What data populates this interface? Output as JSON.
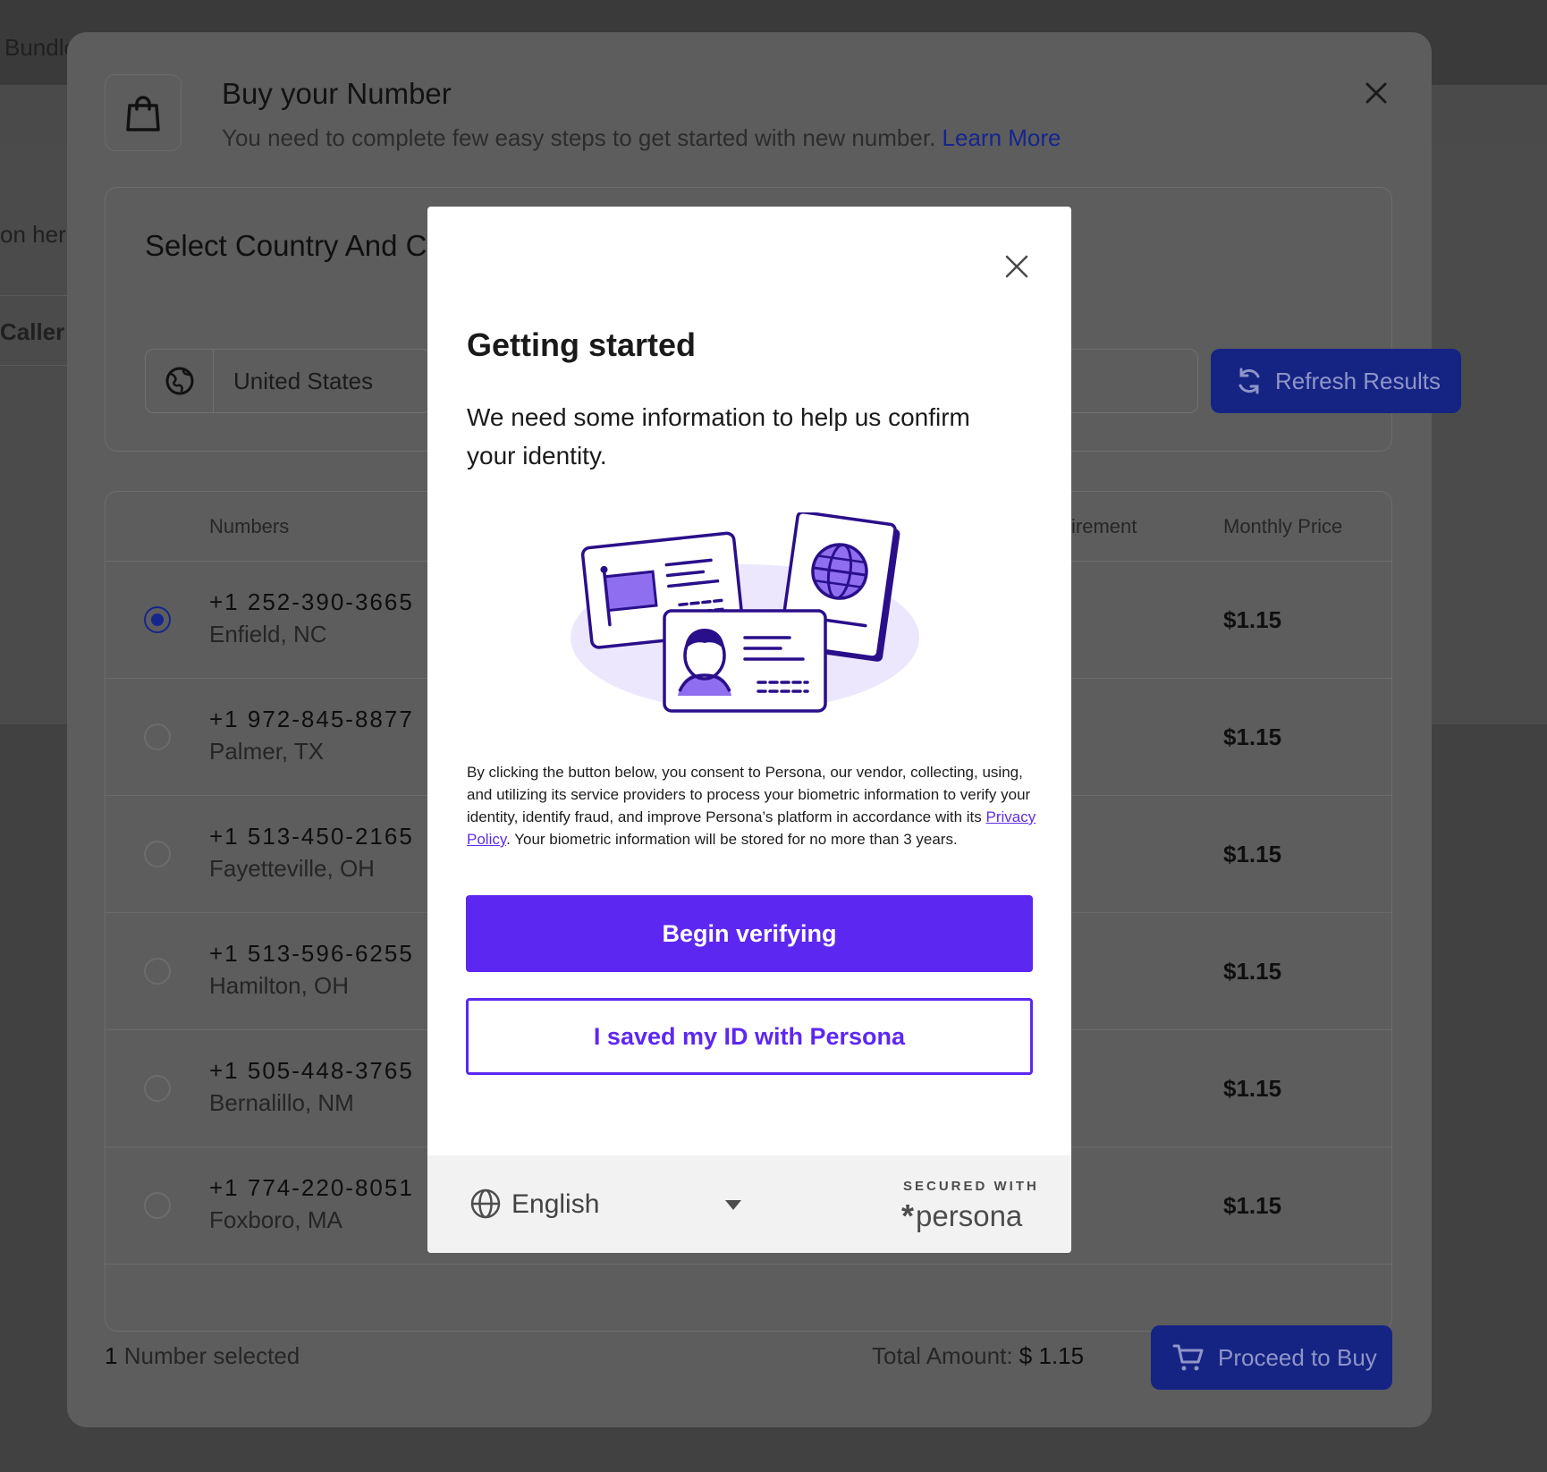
{
  "background": {
    "partial_texts": [
      "Bundle",
      "on her",
      "Caller"
    ]
  },
  "modal": {
    "title": "Buy your Number",
    "subtitle": "You need to complete few easy steps to get started with new number.",
    "learn_more": "Learn More",
    "select_title": "Select Country And C",
    "country_value": "United States",
    "refresh_label": "Refresh Results",
    "table": {
      "headers": [
        "Numbers",
        "irement",
        "Monthly Price"
      ],
      "rows": [
        {
          "number": "+1 252-390-3665",
          "location": "Enfield, NC",
          "price": "$1.15",
          "selected": true
        },
        {
          "number": "+1 972-845-8877",
          "location": "Palmer, TX",
          "price": "$1.15",
          "selected": false
        },
        {
          "number": "+1 513-450-2165",
          "location": "Fayetteville, OH",
          "price": "$1.15",
          "selected": false
        },
        {
          "number": "+1 513-596-6255",
          "location": "Hamilton, OH",
          "price": "$1.15",
          "selected": false
        },
        {
          "number": "+1 505-448-3765",
          "location": "Bernalillo, NM",
          "price": "$1.15",
          "selected": false
        },
        {
          "number": "+1 774-220-8051",
          "location": "Foxboro, MA",
          "price": "$1.15",
          "selected": false
        }
      ]
    },
    "footer": {
      "selected_count": "1",
      "selected_text": "Number selected",
      "total_label": "Total Amount:",
      "total_value": "$ 1.15",
      "proceed_label": "Proceed to Buy"
    }
  },
  "dialog": {
    "title": "Getting started",
    "body": "We need some information to help us confirm your identity.",
    "consent_before": "By clicking the button below, you consent to Persona, our vendor, collecting, using, and utilizing its service providers to process your biometric information to verify your identity, identify fraud, and improve Persona’s platform in accordance with its ",
    "privacy_policy": "Privacy Policy",
    "consent_after": ". Your biometric information will be stored for no more than 3 years.",
    "begin_label": "Begin verifying",
    "saved_label": "I saved my ID with Persona",
    "language": "English",
    "secured_with": "SECURED WITH",
    "brand_mark": "*",
    "brand": "persona"
  },
  "colors": {
    "persona_purple": "#5d27f2",
    "primary_blue": "#152383"
  }
}
